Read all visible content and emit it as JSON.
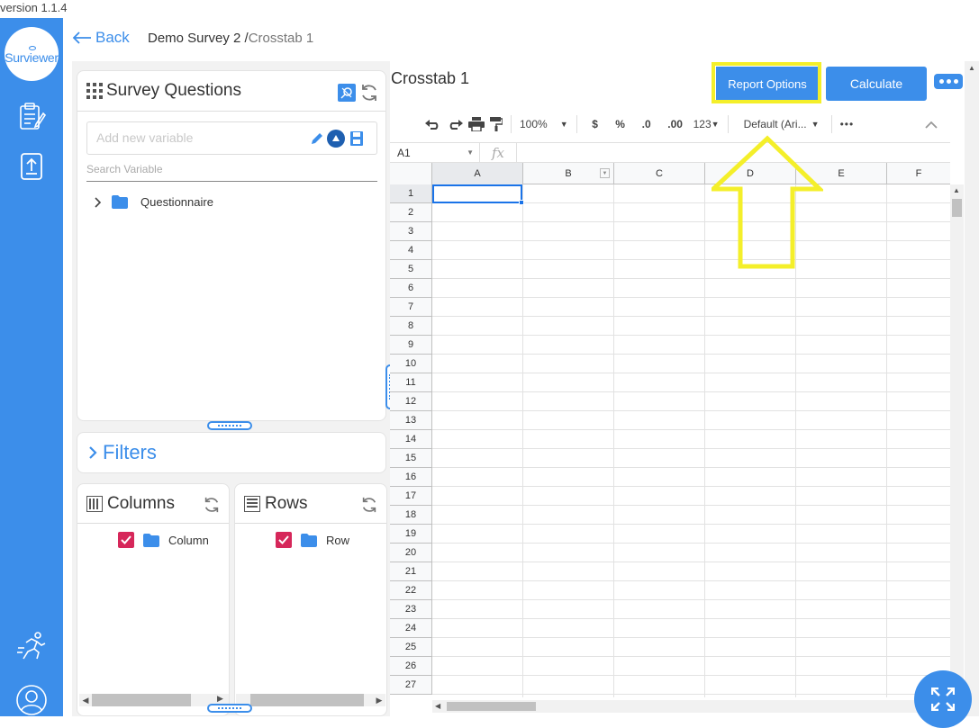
{
  "app": {
    "version": "version 1.1.4",
    "logo_text": "Surviewer"
  },
  "colors": {
    "accent": "#3c8eea",
    "highlight": "#f4ef2a",
    "checkbox": "#d6275a"
  },
  "header": {
    "back_label": "Back",
    "breadcrumb_main": "Demo Survey 2 /",
    "breadcrumb_sub": "Crosstab 1"
  },
  "sidebar_icons": [
    "clipboard-icon",
    "upload-icon",
    "runner-icon",
    "user-icon"
  ],
  "survey_questions": {
    "title": "Survey Questions",
    "add_variable_placeholder": "Add new variable",
    "search_label": "Search Variable",
    "tree": [
      {
        "label": "Questionnaire"
      }
    ]
  },
  "filters": {
    "title": "Filters"
  },
  "columns": {
    "title": "Columns",
    "items": [
      {
        "label": "Column",
        "checked": true
      }
    ]
  },
  "rows": {
    "title": "Rows",
    "items": [
      {
        "label": "Row",
        "checked": true
      }
    ]
  },
  "sheet": {
    "title": "Crosstab 1",
    "report_options_label": "Report Options",
    "calculate_label": "Calculate",
    "toolbar": {
      "zoom": "100%",
      "currency": "$",
      "percent": "%",
      "dec_decrease": ".0",
      "dec_increase": ".00",
      "number_format": "123",
      "font": "Default (Ari...",
      "more": "•••"
    },
    "cell_ref": "A1",
    "fx": "fx",
    "column_headers": [
      "A",
      "B",
      "C",
      "D",
      "E",
      "F"
    ],
    "row_headers": [
      "1",
      "2",
      "3",
      "4",
      "5",
      "6",
      "7",
      "8",
      "9",
      "10",
      "11",
      "12",
      "13",
      "14",
      "15",
      "16",
      "17",
      "18",
      "19",
      "20",
      "21",
      "22",
      "23",
      "24",
      "25",
      "26",
      "27"
    ]
  }
}
